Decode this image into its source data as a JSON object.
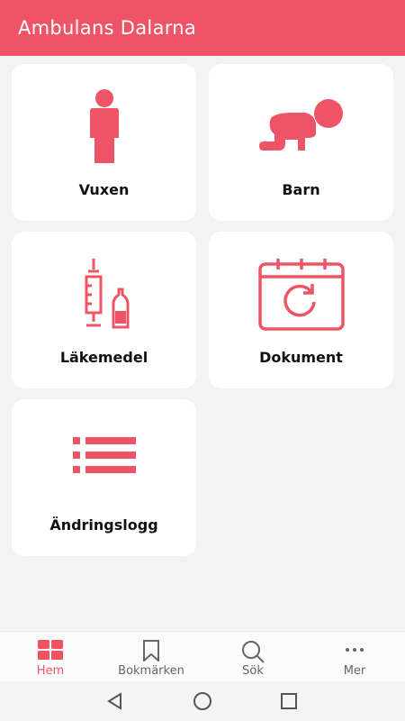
{
  "app": {
    "title": "Ambulans Dalarna"
  },
  "tiles": [
    {
      "label": "Vuxen",
      "icon": "adult-person-icon"
    },
    {
      "label": "Barn",
      "icon": "crawling-baby-icon"
    },
    {
      "label": "Läkemedel",
      "icon": "syringe-ampoule-icon"
    },
    {
      "label": "Dokument",
      "icon": "calendar-refresh-icon"
    },
    {
      "label": "Ändringslogg",
      "icon": "list-icon"
    }
  ],
  "bottom_nav": [
    {
      "label": "Hem",
      "icon": "grid-icon",
      "active": true
    },
    {
      "label": "Bokmärken",
      "icon": "bookmark-icon",
      "active": false
    },
    {
      "label": "Sök",
      "icon": "search-icon",
      "active": false
    },
    {
      "label": "Mer",
      "icon": "more-dots-icon",
      "active": false
    }
  ],
  "system_nav": [
    "back-icon",
    "home-icon",
    "recents-icon"
  ],
  "colors": {
    "accent": "#ef5466",
    "background": "#f3f3f3",
    "tile": "#ffffff"
  }
}
